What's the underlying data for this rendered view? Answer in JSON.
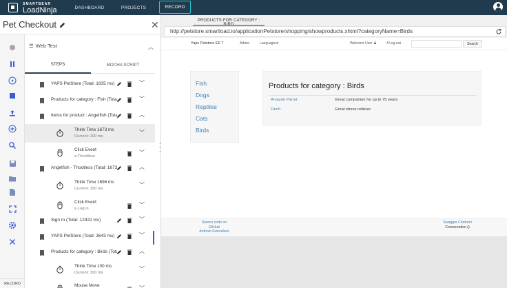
{
  "topbar": {
    "brand_small": "SMARTBEAR",
    "brand_big": "LoadNinja",
    "nav": {
      "dashboard": "DASHBOARD",
      "projects": "PROJECTS",
      "record": "RECORD"
    }
  },
  "left": {
    "title": "Pet Checkout",
    "rail_label": "RECORD",
    "webtest_label": "Web Test",
    "tabs": {
      "steps": "STEPS",
      "mocha": "MOCHA SCRIPT"
    },
    "steps": [
      {
        "text": "YAPS PetStore (Total: 1835 ms)",
        "chevron": "down"
      },
      {
        "text": "Products for category : Fish (Total: ...",
        "chevron": "down"
      },
      {
        "text": "Items for product : Angelfish (Total: ...",
        "chevron": "up"
      },
      {
        "title": "Think Time 1673 ms",
        "detail": "Current: 100 ms"
      },
      {
        "title": "Click Event",
        "detail": "a Thootless"
      },
      {
        "text": "Angelfish - Thootless (Total: 1673 ms)",
        "chevron": "up"
      },
      {
        "title": "Think Time 1696 ms",
        "detail": "Current: 100 ms"
      },
      {
        "title": "Click Event",
        "detail": "a Log in"
      },
      {
        "text": "Sign In (Total: 12922 ms)",
        "chevron": "down"
      },
      {
        "text": "YAPS PetStore (Total: 3643 ms)",
        "chevron": "down"
      },
      {
        "text": "Products for category : Birds (Total: ...",
        "chevron": "up"
      },
      {
        "title": "Think Time 100 ms",
        "detail": "Current: 100 ms"
      },
      {
        "title": "Mouse Move",
        "detail": ""
      }
    ]
  },
  "browser": {
    "tab_label": "PRODUCTS FOR CATEGORY : BIRD",
    "url": "http://petstore.smartload.io/applicationPetstore/shopping/showproducts.xhtml?categoryName=Birds"
  },
  "site": {
    "brand": "Yaps Petstore EE 7",
    "admin": "Admin",
    "languages": "Languages▾",
    "welcome": "Welcome User ♟",
    "logout": "⇱Log out",
    "search_button": "Search",
    "categories": [
      "Fish",
      "Dogs",
      "Reptiles",
      "Cats",
      "Birds"
    ],
    "product_title": "Products for category : Birds",
    "products": [
      {
        "name": "Amazon Parrot",
        "desc": "Great companion for up to 75 years"
      },
      {
        "name": "Finch",
        "desc": "Great stress reliever"
      }
    ],
    "footer_left": [
      "Source code on",
      "GitHub",
      "Antonio Goncalves"
    ],
    "footer_right": [
      "Swagger Contract",
      "Conversation ()"
    ]
  },
  "colors": {
    "topbar": "#1f3b4d",
    "record_border": "#2ec5d5",
    "link": "#3d7fb0",
    "highlight_row": "#ececec"
  }
}
